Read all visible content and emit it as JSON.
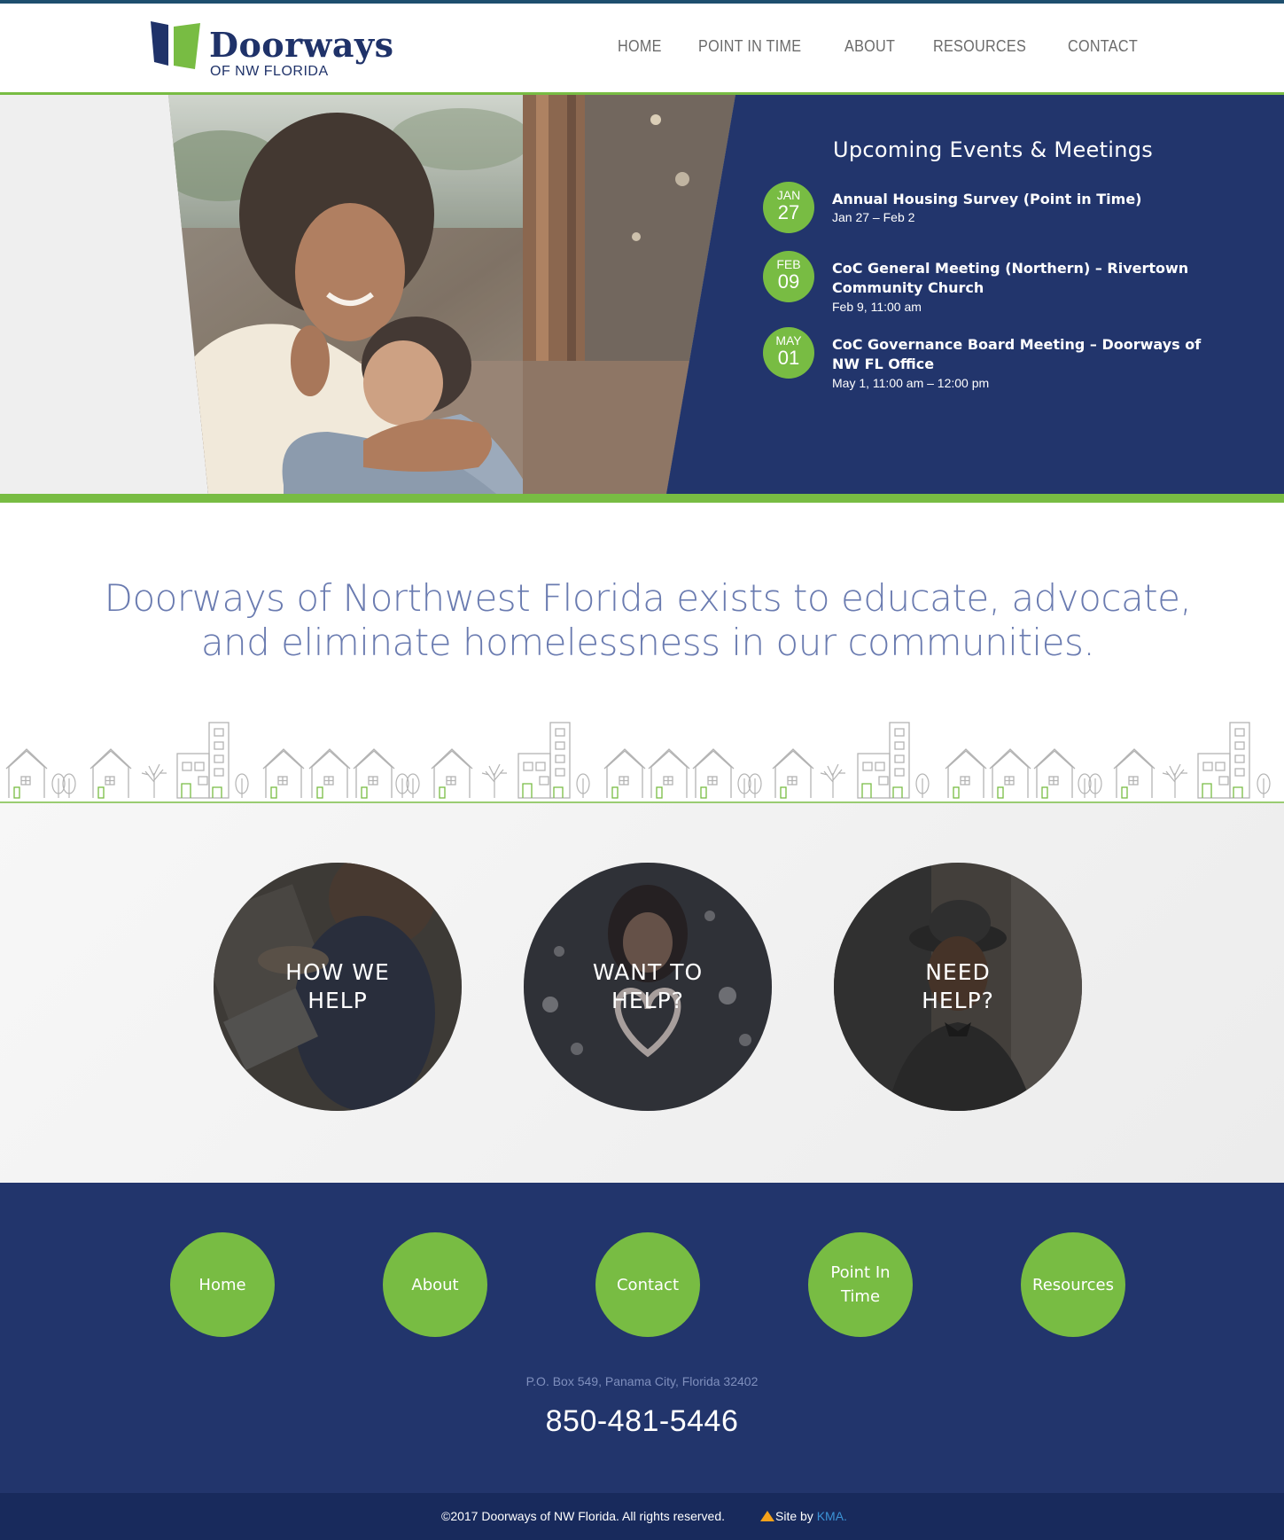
{
  "brand": {
    "name": "Doorways",
    "subtitle": "OF NW FLORIDA",
    "colors": {
      "navy": "#22356c",
      "green": "#78bc43",
      "topline": "#1e4f6e"
    }
  },
  "nav": {
    "items": [
      "HOME",
      "POINT IN TIME",
      "ABOUT",
      "RESOURCES",
      "CONTACT"
    ]
  },
  "hero": {
    "image": "mother-and-daughter-hugging-photo",
    "events_title": "Upcoming Events & Meetings",
    "events": [
      {
        "month": "JAN",
        "day": "27",
        "title": "Annual Housing Survey (Point in Time)",
        "date": "Jan 27 – Feb 2"
      },
      {
        "month": "FEB",
        "day": "09",
        "title": "CoC General Meeting (Northern) – Rivertown Community Church",
        "date": "Feb 9, 11:00 am"
      },
      {
        "month": "MAY",
        "day": "01",
        "title": "CoC Governance Board Meeting – Doorways of NW FL Office",
        "date": "May 1, 11:00 am – 12:00 pm"
      }
    ]
  },
  "mission": {
    "text": "Doorways of Northwest Florida exists to educate, advocate, and eliminate homelessness in our communities."
  },
  "circles": [
    {
      "label": "HOW WE\nHELP",
      "image": "person-writing-photo"
    },
    {
      "label": "WANT TO\nHELP?",
      "image": "heart-sparkler-photo"
    },
    {
      "label": "NEED\nHELP?",
      "image": "man-in-hat-photo"
    }
  ],
  "footer": {
    "buttons": [
      "Home",
      "About",
      "Contact",
      "Point In Time",
      "Resources"
    ],
    "address": "P.O. Box 549, Panama City, Florida 32402",
    "phone": "850-481-5446",
    "copyright": "©2017 Doorways of NW Florida. All rights reserved.",
    "site_by_prefix": "Site by ",
    "site_by_link": "KMA."
  }
}
